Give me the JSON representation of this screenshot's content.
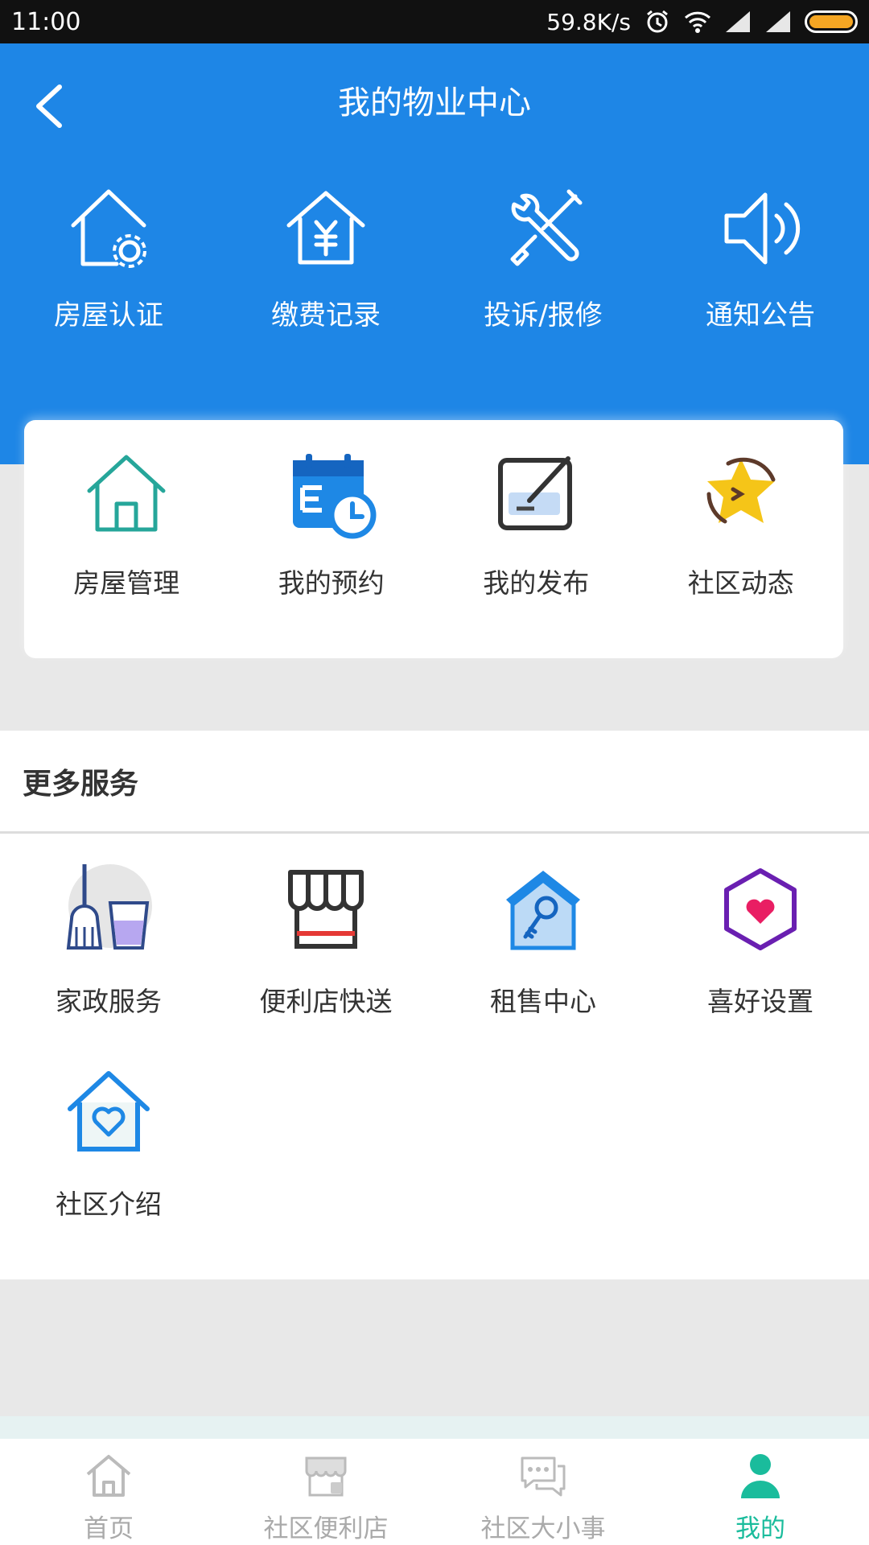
{
  "status_bar": {
    "time": "11:00",
    "speed": "59.8K/s"
  },
  "header": {
    "title": "我的物业中心"
  },
  "top_actions": [
    {
      "label": "房屋认证",
      "icon": "house-gear-icon"
    },
    {
      "label": "缴费记录",
      "icon": "house-yen-icon"
    },
    {
      "label": "投诉/报修",
      "icon": "tools-icon"
    },
    {
      "label": "通知公告",
      "icon": "speaker-icon"
    }
  ],
  "card_actions": [
    {
      "label": "房屋管理",
      "icon": "house-icon"
    },
    {
      "label": "我的预约",
      "icon": "calendar-clock-icon"
    },
    {
      "label": "我的发布",
      "icon": "edit-icon"
    },
    {
      "label": "社区动态",
      "icon": "chat-star-icon"
    }
  ],
  "more_services": {
    "title": "更多服务",
    "items": [
      {
        "label": "家政服务",
        "icon": "broom-bucket-icon"
      },
      {
        "label": "便利店快送",
        "icon": "store-icon"
      },
      {
        "label": "租售中心",
        "icon": "house-key-icon"
      },
      {
        "label": "喜好设置",
        "icon": "hexagon-heart-icon"
      },
      {
        "label": "社区介绍",
        "icon": "house-heart-icon"
      }
    ]
  },
  "tabbar": {
    "items": [
      {
        "label": "首页",
        "icon": "home-icon",
        "active": false
      },
      {
        "label": "社区便利店",
        "icon": "shop-icon",
        "active": false
      },
      {
        "label": "社区大小事",
        "icon": "chat-bubbles-icon",
        "active": false
      },
      {
        "label": "我的",
        "icon": "person-icon",
        "active": true
      }
    ]
  },
  "colors": {
    "primary": "#1e86e6",
    "active_tab": "#1abc9c",
    "inactive_tab": "#aaaaaa"
  }
}
